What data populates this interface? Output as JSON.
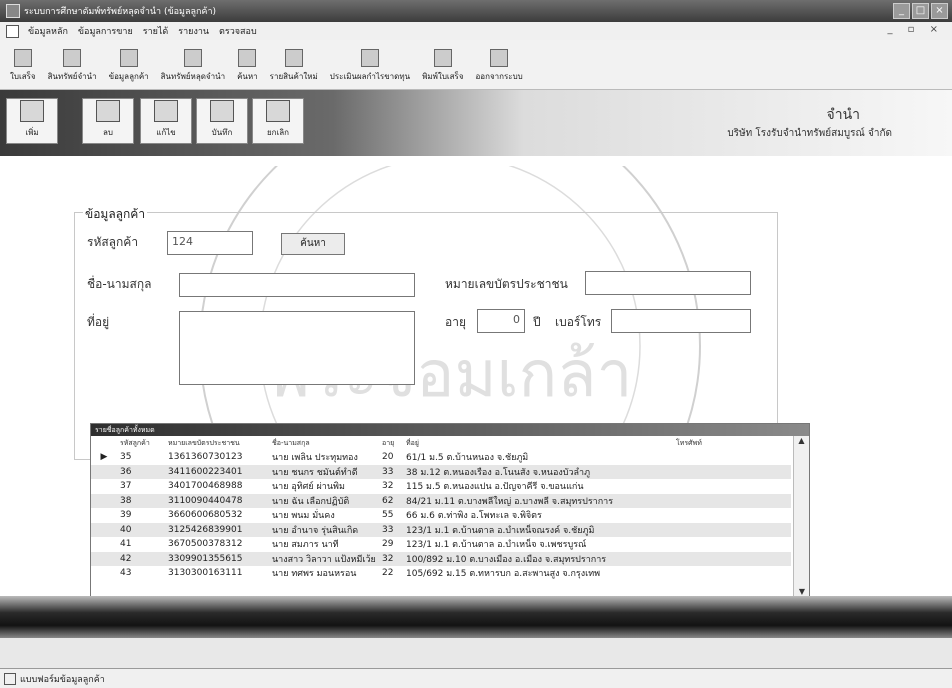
{
  "window": {
    "title": "ระบบการศึกษาดัมพ์ทรัพย์หลุดจำนำ (ข้อมูลลูกค้า)",
    "min": "_",
    "max": "□",
    "close": "×"
  },
  "menu": {
    "items": [
      "ข้อมูลหลัก",
      "ข้อมูลการขาย",
      "รายได้",
      "รายงาน",
      "ตรวจสอบ"
    ],
    "mdi_controls": "_ ▫ ×"
  },
  "toolbar": {
    "items": [
      "ใบเสร็จ",
      "สินทรัพย์จำนำ",
      "ข้อมูลลูกค้า",
      "สินทรัพย์หลุดจำนำ",
      "ค้นหา",
      "รายสินค้าใหม่",
      "ประเมินผลกำไรขาดทุน",
      "พิมพ์ใบเสร็จ",
      "ออกจากระบบ"
    ]
  },
  "actions": {
    "add": "เพิ่ม",
    "delete": "ลบ",
    "edit": "แก้ไข",
    "save": "บันทึก",
    "cancel": "ยกเลิก"
  },
  "header": {
    "section": "จำนำ",
    "company": "บริษัท โรงรับจำนำทรัพย์สมบูรณ์ จำกัด"
  },
  "form": {
    "legend": "ข้อมูลลูกค้า",
    "customer_id_label": "รหัสลูกค้า",
    "customer_id_value": "124",
    "search_button": "ค้นหา",
    "name_label": "ชื่อ-นามสกุล",
    "name_value": "",
    "id_card_label": "หมายเลขบัตรประชาชน",
    "id_card_value": "",
    "address_label": "ที่อยู่",
    "address_value": "",
    "age_label": "อายุ",
    "age_value": "0",
    "age_unit": "ปี",
    "phone_label": "เบอร์โทร",
    "phone_value": ""
  },
  "grid": {
    "title": "รายชื่อลูกค้าทั้งหมด",
    "columns": [
      "รหัสลูกค้า",
      "หมายเลขบัตรประชาชน",
      "ชื่อ-นามสกุล",
      "อายุ",
      "ที่อยู่",
      "โทรศัพท์"
    ],
    "rows": [
      {
        "id": "35",
        "card": "1361360730123",
        "name": "นาย เพลิน ประทุมทอง",
        "age": "20",
        "address": "61/1 ม.5 ต.บ้านหนอง จ.ชัยภูมิ",
        "phone": ""
      },
      {
        "id": "36",
        "card": "3411600223401",
        "name": "นาย ชนกร ชมันต์ทำดี",
        "age": "33",
        "address": "38 ม.12 ต.หนองเรือง อ.โนนสัง จ.หนองบัวลำภู",
        "phone": ""
      },
      {
        "id": "37",
        "card": "3401700468988",
        "name": "นาย อุทิศย์ ผ่านพิม",
        "age": "32",
        "address": "115 ม.5 ต.หนองแปน อ.ปัญจาคีรี จ.ขอนแก่น",
        "phone": ""
      },
      {
        "id": "38",
        "card": "3110090440478",
        "name": "นาย ฉัน เลือกปฏิบัติ",
        "age": "62",
        "address": "84/21 ม.11 ต.บางพลีใหญ่ อ.บางพลี จ.สมุทรปราการ",
        "phone": ""
      },
      {
        "id": "39",
        "card": "3660600680532",
        "name": "นาย พนม มั่นคง",
        "age": "55",
        "address": "66 ม.6 ต.ท่าพิง อ.โพทะเล จ.พิจิตร",
        "phone": ""
      },
      {
        "id": "40",
        "card": "3125426839901",
        "name": "นาย อำนาจ รุ่นสินเกิด",
        "age": "33",
        "address": "123/1 ม.1 ต.บ้านตาล อ.บำเหน็จณรงค์ จ.ชัยภูมิ",
        "phone": ""
      },
      {
        "id": "41",
        "card": "3670500378312",
        "name": "นาย สมภาร นาที",
        "age": "29",
        "address": "123/1 ม.1 ต.บ้านตาล อ.บำเหน็จ จ.เพชรบูรณ์",
        "phone": ""
      },
      {
        "id": "42",
        "card": "3309901355615",
        "name": "นางสาว วิลาวา แป้งหมีเว้ย",
        "age": "32",
        "address": "100/892 ม.10 ต.บางเมือง อ.เมือง จ.สมุทรปราการ",
        "phone": ""
      },
      {
        "id": "43",
        "card": "3130300163111",
        "name": "นาย ทศพร มอนหรอน",
        "age": "22",
        "address": "105/692 ม.15 ต.ทหารบก อ.สะพานสูง จ.กรุงเทพ",
        "phone": ""
      }
    ]
  },
  "statusbar": {
    "text": "แบบฟอร์มข้อมูลลูกค้า"
  },
  "colors": {
    "banner_dark": "#3a3a3a",
    "band_dark": "#121212",
    "row_alt": "#e6e6e6"
  }
}
